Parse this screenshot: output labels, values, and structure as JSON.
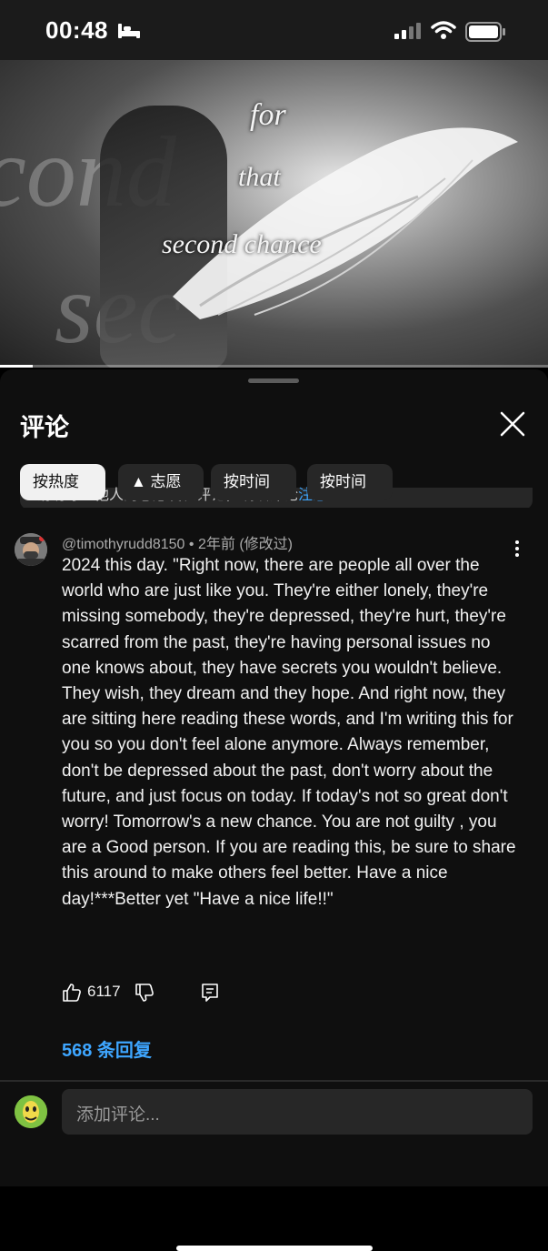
{
  "status_bar": {
    "time": "00:48"
  },
  "video": {
    "overlay_words": [
      "for",
      "that",
      "second chance"
    ],
    "progress_fraction": 0.06
  },
  "comments_panel": {
    "title": "评论",
    "sort_chips": [
      "按热度",
      "▲ 志愿",
      "按时间",
      "按时间"
    ],
    "notice_text": "请劝尊重他人的志愿发表评论，确认评论",
    "notice_link": "注意"
  },
  "comment": {
    "author": "@timothyrudd8150",
    "time": "2年前",
    "edited": "(修改过)",
    "separator": "•",
    "text": "2024 this day. \"Right now, there are people all over the world who are just like you. They're either lonely, they're missing somebody, they're depressed, they're hurt, they're scarred from the past, they're having personal issues no one knows about, they have secrets you wouldn't believe. They wish, they dream and they hope. And right now, they are sitting here reading these words, and I'm writing this for you so you don't feel alone anymore. Always remember, don't be depressed about the past, don't worry about the future, and just focus on today. If today's not so great don't worry! Tomorrow's a new chance. You are not guilty , you are a Good person. If you are reading this, be sure to share this around to make others feel better. Have a nice day!***Better yet \"Have a nice life!!\"",
    "likes": "6117",
    "replies_label": "568 条回复"
  },
  "composer": {
    "placeholder": "添加评论..."
  }
}
